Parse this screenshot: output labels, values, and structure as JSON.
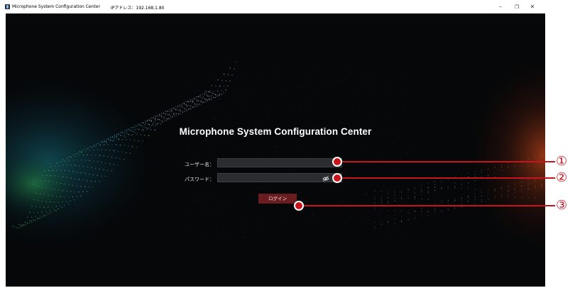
{
  "window": {
    "title": "Microphone System Configuration Center",
    "ip_label": "IPアドレス：192.168.1.80",
    "minimize": "–",
    "maximize": "❐",
    "close": "✕"
  },
  "login": {
    "heading": "Microphone System Configuration Center",
    "username_label": "ユーザー名：",
    "username_value": "",
    "password_label": "パスワード：",
    "password_value": "",
    "login_button": "ログイン"
  },
  "callouts": [
    "①",
    "②",
    "③"
  ],
  "colors": {
    "background": "#050708",
    "accent_red": "#c8141c",
    "button": "#6b1c1e"
  }
}
